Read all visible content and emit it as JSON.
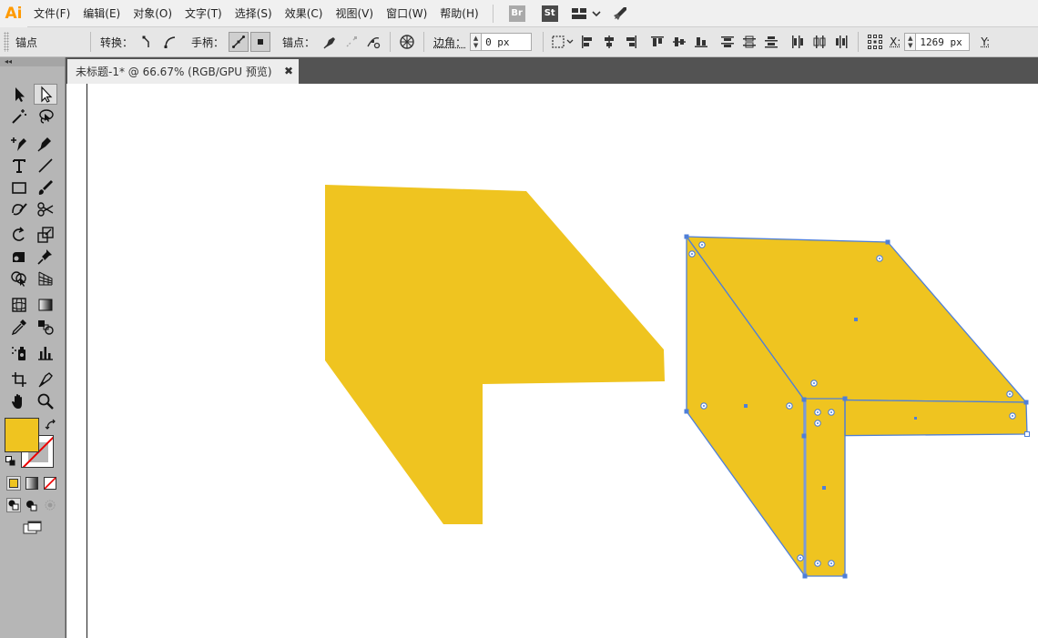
{
  "app": {
    "logo": "Ai"
  },
  "menu": [
    "文件(F)",
    "编辑(E)",
    "对象(O)",
    "文字(T)",
    "选择(S)",
    "效果(C)",
    "视图(V)",
    "窗口(W)",
    "帮助(H)"
  ],
  "menubar_badges": {
    "br": "Br",
    "st": "St"
  },
  "controlbar": {
    "selection_label": "锚点",
    "convert_label": "转换：",
    "handles_label": "手柄：",
    "anchors_label": "锚点：",
    "corner_label": "边角：",
    "corner_value": "0 px",
    "x_label": "X:",
    "x_value": "1269 px",
    "y_label": "Y:"
  },
  "document_tab": {
    "title": "未标题-1* @ 66.67% (RGB/GPU 预览)",
    "close": "✖"
  },
  "toolbox": {
    "collapse": "◂◂"
  },
  "colors": {
    "fill": "#efc420",
    "selection": "#4f7fd8",
    "ui_bg": "#535353"
  }
}
